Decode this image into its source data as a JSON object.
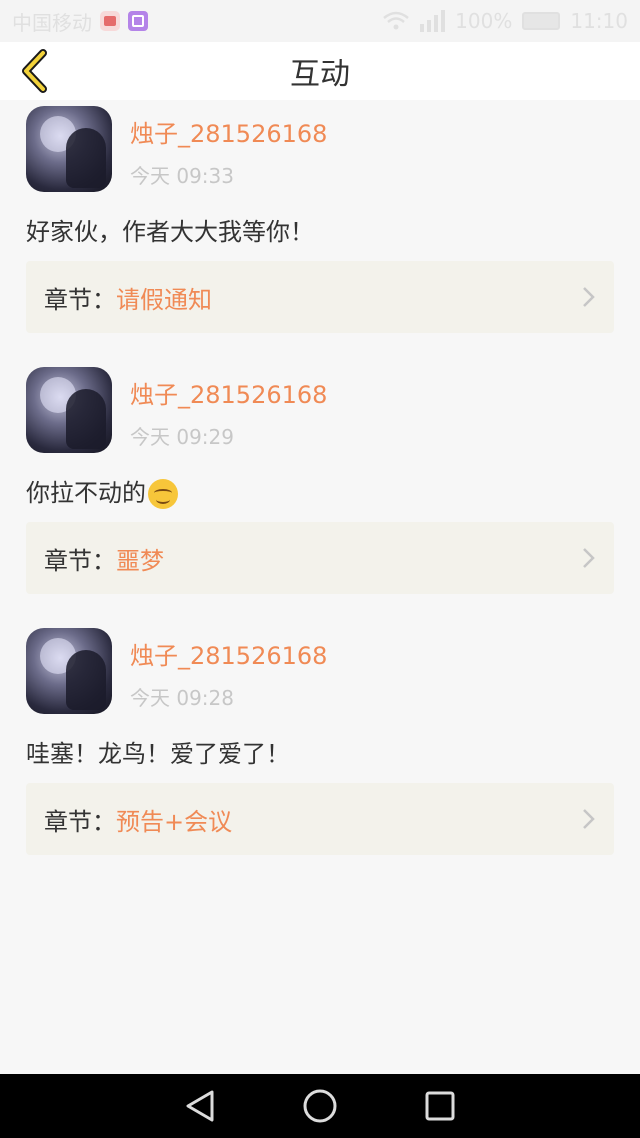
{
  "status_bar": {
    "carrier": "中国移动",
    "battery": "100%",
    "time": "11:10"
  },
  "header": {
    "title": "互动",
    "back_icon": "chevron-left-icon"
  },
  "comments": [
    {
      "username": "烛子_281526168",
      "time": "今天 09:33",
      "text": "好家伙，作者大大我等你！",
      "chapter_label": "章节：",
      "chapter_name": "请假通知"
    },
    {
      "username": "烛子_281526168",
      "time": "今天 09:29",
      "text": "你拉不动的",
      "emoji": "smirk-emoji",
      "chapter_label": "章节：",
      "chapter_name": "噩梦"
    },
    {
      "username": "烛子_281526168",
      "time": "今天 09:28",
      "text": "哇塞！龙鸟！爱了爱了！",
      "chapter_label": "章节：",
      "chapter_name": "预告+会议"
    }
  ],
  "colors": {
    "accent": "#f08a55",
    "back_icon": "#f2d23a",
    "chapter_bg": "#f3f2eb",
    "page_bg": "#f7f7f7"
  },
  "nav_bar": {
    "back": "triangle-back-icon",
    "home": "circle-home-icon",
    "recents": "square-recents-icon"
  }
}
